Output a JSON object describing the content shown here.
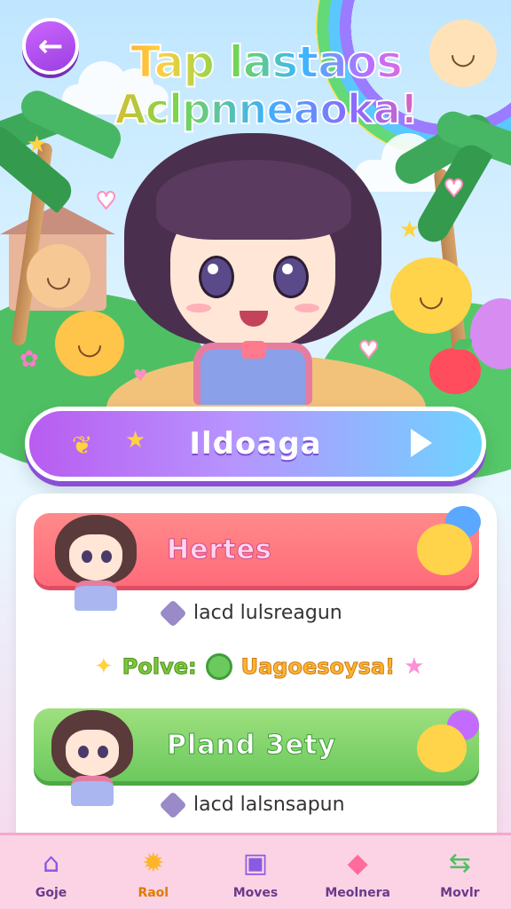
{
  "header": {
    "back_icon": "arrow-left-icon",
    "title_line1": "Tap lastaos",
    "title_line2": "Aclpnneaoka!"
  },
  "start_button": {
    "label": "Ildoaga",
    "icon": "play-icon"
  },
  "cards": [
    {
      "title": "Hertes",
      "info": "lacd lulsreagun",
      "color": "#ff6b7a"
    },
    {
      "title": "Pland 3ety",
      "info": "lacd lalsnsapun",
      "color": "#6cc95d"
    }
  ],
  "reward": {
    "label": "Polve:",
    "value": "Uagoesoysa!"
  },
  "nav": {
    "items": [
      {
        "label": "Goje",
        "icon": "home-icon"
      },
      {
        "label": "Raol",
        "icon": "gear-icon"
      },
      {
        "label": "Moves",
        "icon": "card-icon"
      },
      {
        "label": "Meolnera",
        "icon": "bell-icon"
      },
      {
        "label": "Movlr",
        "icon": "swap-icon"
      }
    ],
    "active_index": 1
  }
}
